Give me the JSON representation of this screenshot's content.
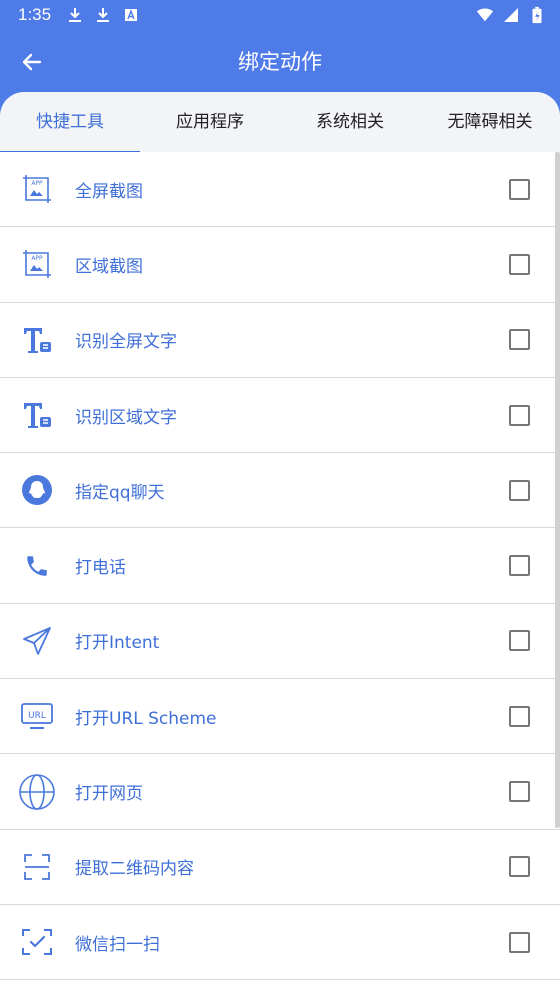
{
  "status_bar": {
    "time": "1:35",
    "left_icons": [
      "download-icon",
      "download-icon",
      "notification-a-icon"
    ],
    "right_icons": [
      "wifi-icon",
      "signal-icon",
      "battery-charging-icon"
    ]
  },
  "header": {
    "title": "绑定动作",
    "back_icon": "arrow-left-icon",
    "background_color": "#4f7be8"
  },
  "tabs": [
    {
      "label": "快捷工具",
      "active": true
    },
    {
      "label": "应用程序",
      "active": false
    },
    {
      "label": "系统相关",
      "active": false
    },
    {
      "label": "无障碍相关",
      "active": false
    }
  ],
  "items": [
    {
      "label": "全屏截图",
      "icon": "fullscreen-screenshot-icon",
      "checked": false
    },
    {
      "label": "区域截图",
      "icon": "area-screenshot-icon",
      "checked": false
    },
    {
      "label": "识别全屏文字",
      "icon": "text-recognition-icon",
      "checked": false
    },
    {
      "label": "识别区域文字",
      "icon": "area-text-recognition-icon",
      "checked": false
    },
    {
      "label": "指定qq聊天",
      "icon": "qq-icon",
      "checked": false
    },
    {
      "label": "打电话",
      "icon": "phone-icon",
      "checked": false
    },
    {
      "label": "打开Intent",
      "icon": "send-icon",
      "checked": false
    },
    {
      "label": "打开URL Scheme",
      "icon": "url-monitor-icon",
      "checked": false
    },
    {
      "label": "打开网页",
      "icon": "globe-icon",
      "checked": false
    },
    {
      "label": "提取二维码内容",
      "icon": "qr-scan-icon",
      "checked": false
    },
    {
      "label": "微信扫一扫",
      "icon": "wechat-scan-icon",
      "checked": false
    }
  ],
  "colors": {
    "accent": "#3f6fd8",
    "header": "#4f7be8",
    "icon": "#4a78dc"
  },
  "icon_text": {
    "app": "APP",
    "url": "URL"
  }
}
